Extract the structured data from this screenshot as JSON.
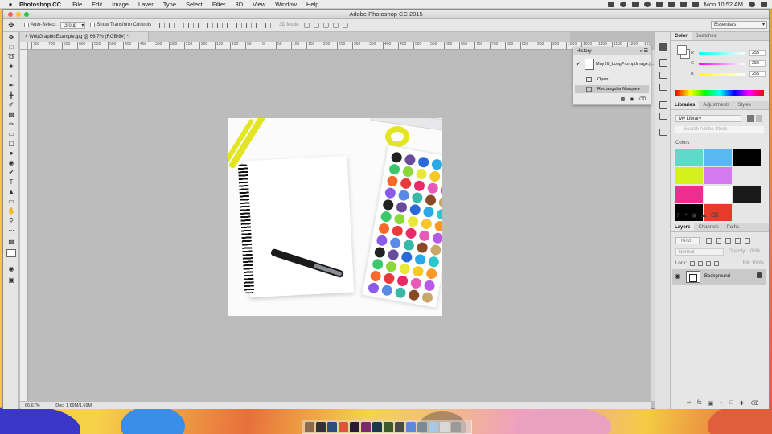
{
  "menubar": {
    "app_name": "Photoshop CC",
    "items": [
      "File",
      "Edit",
      "Image",
      "Layer",
      "Type",
      "Select",
      "Filter",
      "3D",
      "View",
      "Window",
      "Help"
    ],
    "clock": "Mon 10:52 AM"
  },
  "window": {
    "title": "Adobe Photoshop CC 2015"
  },
  "options_bar": {
    "auto_select_label": "Auto-Select:",
    "auto_select_value": "Group",
    "show_transform_label": "Show Transform Controls",
    "mode_3d_label": "3D Mode:",
    "workspace": "Essentials"
  },
  "document": {
    "tab_label": "WebGraphicExample.jpg @ 66.7% (RGB/8#) *",
    "zoom": "66.67%",
    "doc_size": "Doc: 1.69M/1.69M"
  },
  "ruler": {
    "ticks": [
      "750",
      "700",
      "650",
      "600",
      "550",
      "500",
      "450",
      "400",
      "350",
      "300",
      "250",
      "200",
      "150",
      "100",
      "50",
      "0",
      "50",
      "100",
      "150",
      "200",
      "250",
      "300",
      "350",
      "400",
      "450",
      "500",
      "550",
      "600",
      "650",
      "700",
      "750",
      "800",
      "850",
      "900",
      "950",
      "1000",
      "1050",
      "1100",
      "1150",
      "1200",
      "1250"
    ]
  },
  "history": {
    "title": "History",
    "snapshot": "May16_LongPromptImage.j...",
    "steps": [
      "Open",
      "Rectangular Marquee"
    ]
  },
  "color_panel": {
    "tabs": [
      "Color",
      "Swatches"
    ],
    "channels": [
      {
        "label": "R",
        "value": "255",
        "color": "#ff2a2a"
      },
      {
        "label": "G",
        "value": "255",
        "color": "#2ad24a"
      },
      {
        "label": "B",
        "value": "255",
        "color": "#3a5cff"
      }
    ]
  },
  "libraries_panel": {
    "tabs": [
      "Libraries",
      "Adjustments",
      "Styles"
    ],
    "library": "My Library",
    "search_placeholder": "Search Adobe Stock",
    "colors_label": "Colors",
    "swatches": [
      "#5fd9c9",
      "#5ab8f0",
      "#000000",
      "#d4f21a",
      "#d57af0",
      "#e8e8e8",
      "#ec2f8e",
      "#ffffff",
      "#1a1a1a",
      "#000000",
      "#e63a2a",
      "#e6e6e6"
    ]
  },
  "layers_panel": {
    "tabs": [
      "Layers",
      "Channels",
      "Paths"
    ],
    "kind": "Kind",
    "blend_mode": "Normal",
    "opacity_label": "Opacity:",
    "opacity_value": "100%",
    "lock_label": "Lock:",
    "fill_label": "Fill:",
    "fill_value": "100%",
    "layer_name": "Background"
  },
  "colors": {
    "accent": "#e3e523",
    "canvas_bg": "#bdbcbd"
  }
}
